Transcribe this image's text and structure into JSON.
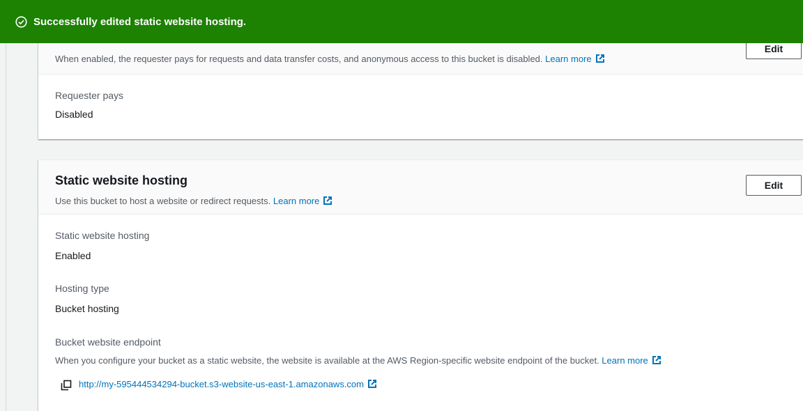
{
  "flash": {
    "message": "Successfully edited static website hosting."
  },
  "requester_pays_panel": {
    "edit_label": "Edit",
    "description": "When enabled, the requester pays for requests and data transfer costs, and anonymous access to this bucket is disabled.",
    "learn_more": "Learn more",
    "field_label": "Requester pays",
    "field_value": "Disabled"
  },
  "static_hosting_panel": {
    "title": "Static website hosting",
    "description": "Use this bucket to host a website or redirect requests.",
    "learn_more": "Learn more",
    "edit_label": "Edit",
    "status_label": "Static website hosting",
    "status_value": "Enabled",
    "hosting_type_label": "Hosting type",
    "hosting_type_value": "Bucket hosting",
    "endpoint_label": "Bucket website endpoint",
    "endpoint_description": "When you configure your bucket as a static website, the website is available at the AWS Region-specific website endpoint of the bucket.",
    "endpoint_learn_more": "Learn more",
    "endpoint_url": "http://my-595444534294-bucket.s3-website-us-east-1.amazonaws.com"
  },
  "icons": {
    "flash_icon": "check-circle-icon",
    "external": "external-link-icon",
    "copy": "copy-icon"
  },
  "colors": {
    "success": "#1d8102",
    "link": "#0073bb"
  }
}
